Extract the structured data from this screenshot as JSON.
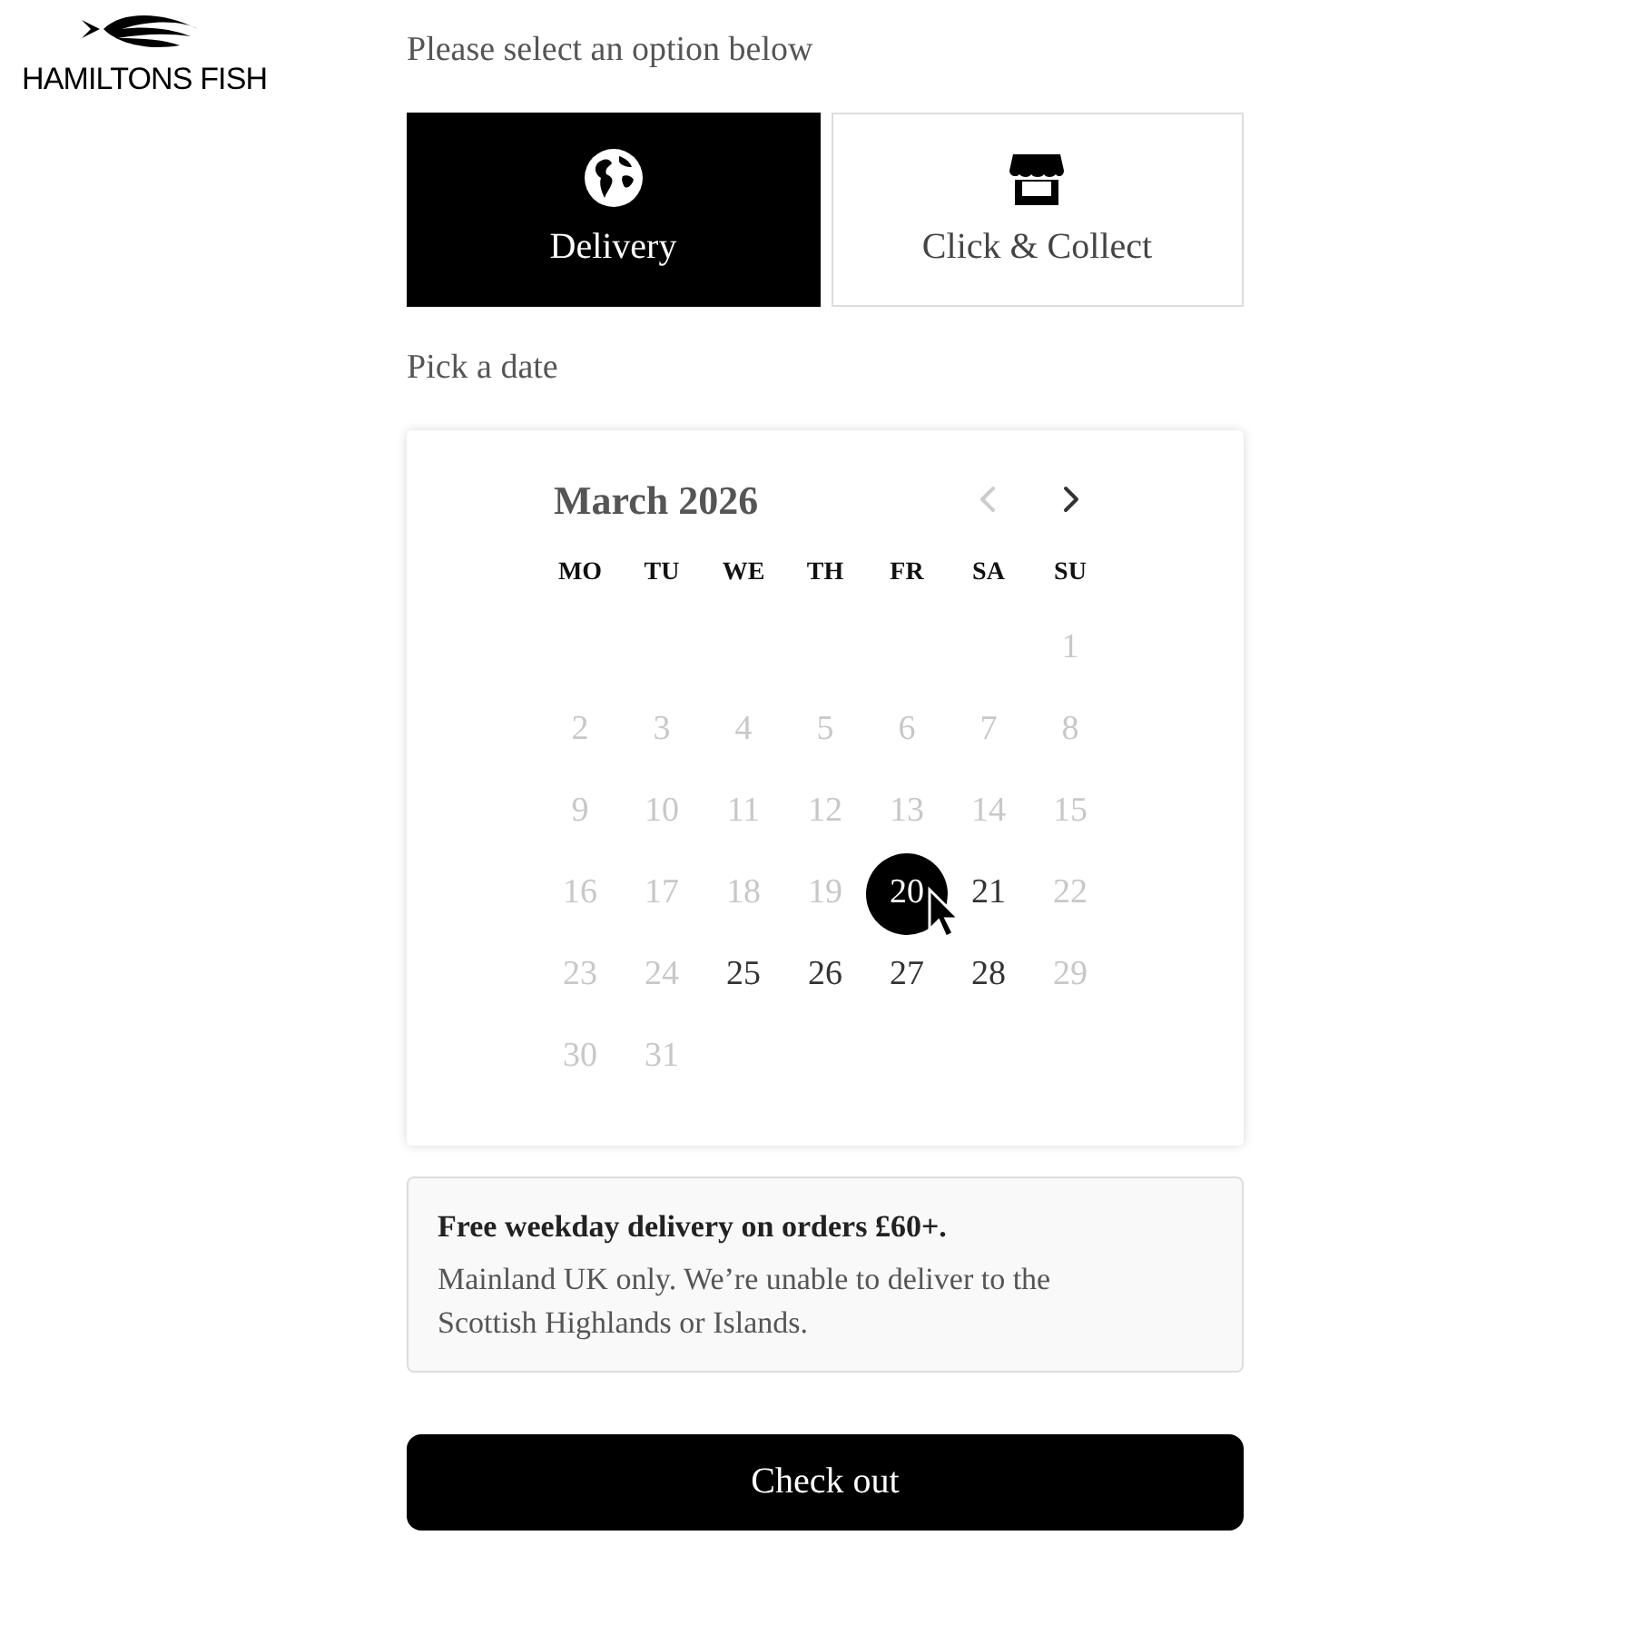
{
  "logo": {
    "text": "HAMILTONS FISH"
  },
  "options_heading": "Please select an option below",
  "options": [
    {
      "kind": "delivery",
      "label": "Delivery",
      "selected": true
    },
    {
      "kind": "collect",
      "label": "Click & Collect",
      "selected": false
    }
  ],
  "date_heading": "Pick a date",
  "calendar": {
    "month": "March 2026",
    "prev_disabled": true,
    "next_disabled": false,
    "weekdays": [
      "MO",
      "TU",
      "WE",
      "TH",
      "FR",
      "SA",
      "SU"
    ],
    "weeks": [
      [
        {
          "day": "1",
          "available": false,
          "selected": false
        }
      ],
      [
        {
          "day": "2",
          "available": false,
          "selected": false
        },
        {
          "day": "3",
          "available": false,
          "selected": false
        },
        {
          "day": "4",
          "available": false,
          "selected": false
        },
        {
          "day": "5",
          "available": false,
          "selected": false
        },
        {
          "day": "6",
          "available": false,
          "selected": false
        },
        {
          "day": "7",
          "available": false,
          "selected": false
        },
        {
          "day": "8",
          "available": false,
          "selected": false
        }
      ],
      [
        {
          "day": "9",
          "available": false,
          "selected": false
        },
        {
          "day": "10",
          "available": false,
          "selected": false
        },
        {
          "day": "11",
          "available": false,
          "selected": false
        },
        {
          "day": "12",
          "available": false,
          "selected": false
        },
        {
          "day": "13",
          "available": false,
          "selected": false
        },
        {
          "day": "14",
          "available": false,
          "selected": false
        },
        {
          "day": "15",
          "available": false,
          "selected": false
        }
      ],
      [
        {
          "day": "16",
          "available": false,
          "selected": false
        },
        {
          "day": "17",
          "available": false,
          "selected": false
        },
        {
          "day": "18",
          "available": false,
          "selected": false
        },
        {
          "day": "19",
          "available": false,
          "selected": false
        },
        {
          "day": "20",
          "available": true,
          "selected": true
        },
        {
          "day": "21",
          "available": true,
          "selected": false
        },
        {
          "day": "22",
          "available": false,
          "selected": false
        }
      ],
      [
        {
          "day": "23",
          "available": false,
          "selected": false
        },
        {
          "day": "24",
          "available": false,
          "selected": false
        },
        {
          "day": "25",
          "available": true,
          "selected": false
        },
        {
          "day": "26",
          "available": true,
          "selected": false
        },
        {
          "day": "27",
          "available": true,
          "selected": false
        },
        {
          "day": "28",
          "available": true,
          "selected": false
        },
        {
          "day": "29",
          "available": false,
          "selected": false
        }
      ],
      [
        {
          "day": "30",
          "available": false,
          "selected": false
        },
        {
          "day": "31",
          "available": false,
          "selected": false
        }
      ]
    ]
  },
  "notice": {
    "title": "Free weekday delivery on orders £60+.",
    "body": "Mainland UK only. We’re unable to deliver to the Scottish Highlands or Islands."
  },
  "checkout_button": "Check out"
}
